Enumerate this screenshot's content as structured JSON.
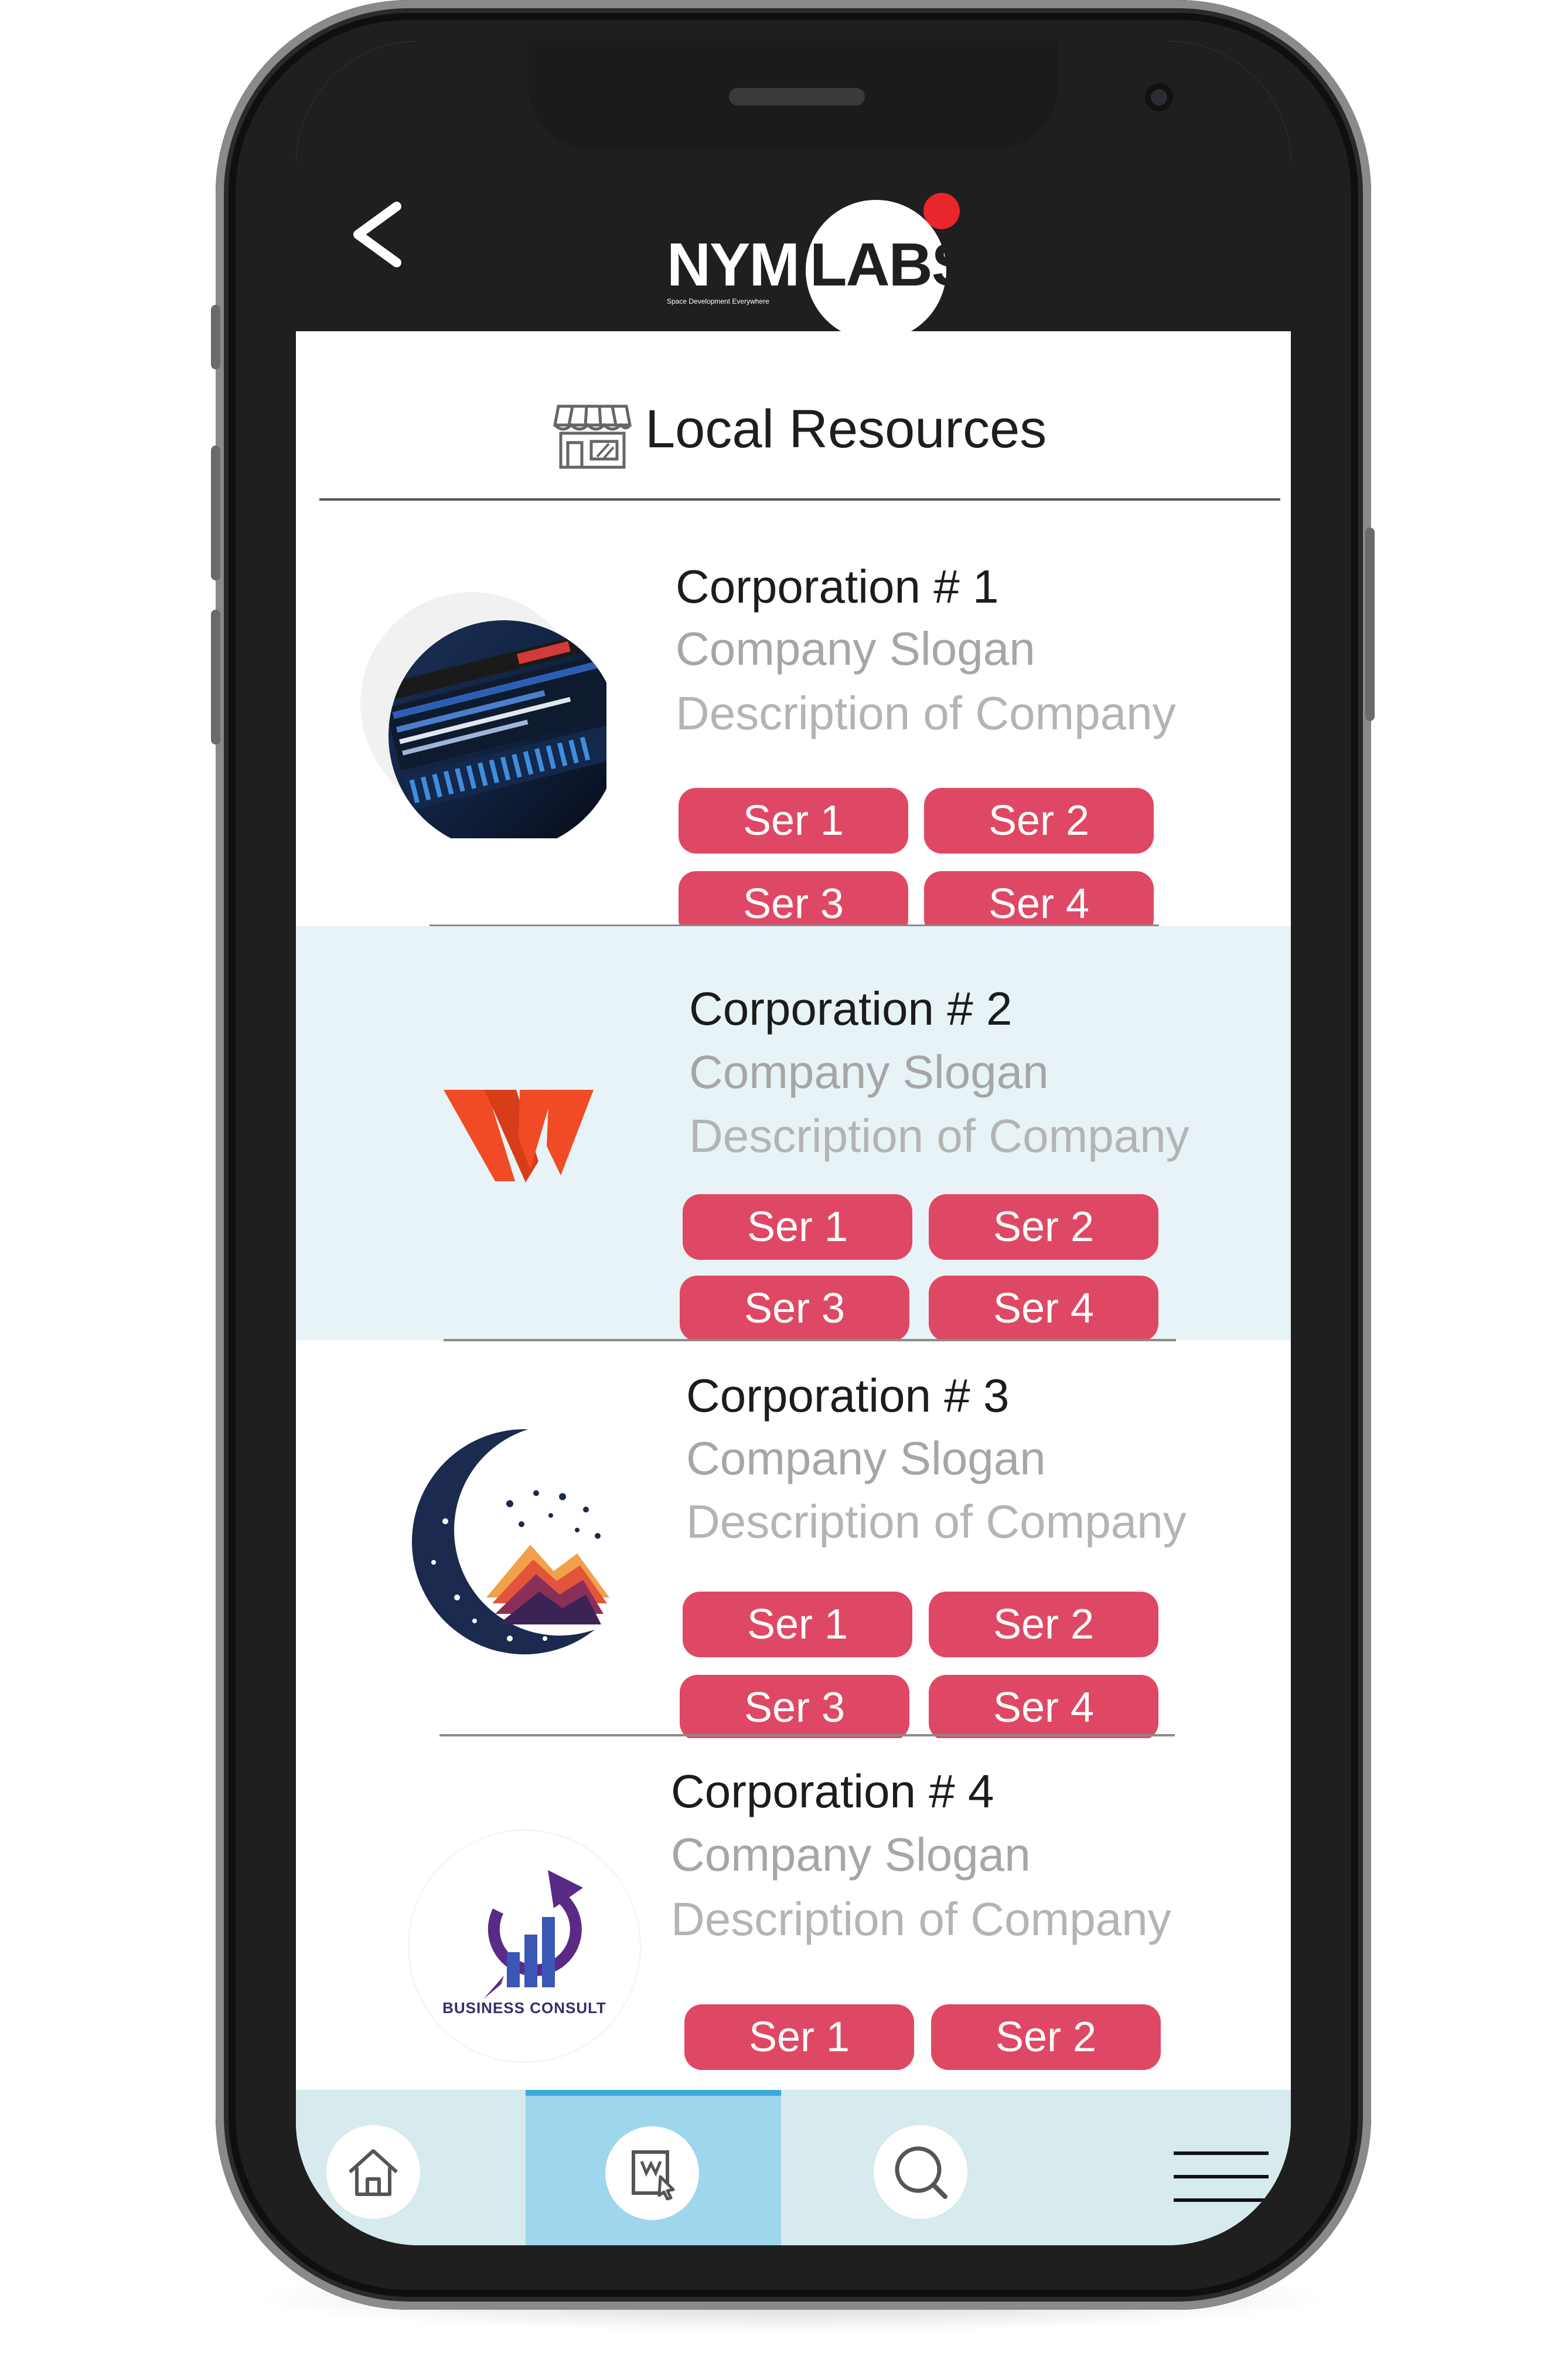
{
  "app": {
    "logo_left": "NYM",
    "logo_right": "LABS",
    "logo_tagline": "Space Development Everywhere"
  },
  "header": {
    "title": "Local Resources",
    "icon": "store-icon",
    "back_icon": "chevron-left-icon"
  },
  "colors": {
    "accent": "#df4864",
    "app_bar": "#1f1f1f",
    "highlight_row": "#e7f3f6",
    "tabbar": "#d7eaee",
    "active_tab": "#9dd6ed",
    "logo_dot": "#e8262b"
  },
  "companies": [
    {
      "name": "Corporation # 1",
      "slogan": "Company Slogan",
      "description": "Description of Company",
      "services": [
        "Ser 1",
        "Ser 2",
        "Ser 3",
        "Ser 4"
      ],
      "logo": "circuit-board-logo"
    },
    {
      "name": "Corporation # 2",
      "slogan": "Company Slogan",
      "description": "Description of Company",
      "services": [
        "Ser 1",
        "Ser 2",
        "Ser 3",
        "Ser 4"
      ],
      "logo": "w-letter-logo"
    },
    {
      "name": "Corporation # 3",
      "slogan": "Company Slogan",
      "description": "Description of Company",
      "services": [
        "Ser 1",
        "Ser 2",
        "Ser 3",
        "Ser 4"
      ],
      "logo": "moon-mountain-logo"
    },
    {
      "name": "Corporation # 4",
      "slogan": "Company Slogan",
      "description": "Description of Company",
      "services": [
        "Ser 1",
        "Ser 2"
      ],
      "logo": "business-consult-logo",
      "logo_text": "BUSINESS CONSULT"
    }
  ],
  "tabbar": {
    "tabs": [
      {
        "icon": "home-icon",
        "active": false
      },
      {
        "icon": "directory-icon",
        "active": true
      },
      {
        "icon": "search-icon",
        "active": false
      },
      {
        "icon": "menu-icon",
        "active": false
      }
    ]
  }
}
